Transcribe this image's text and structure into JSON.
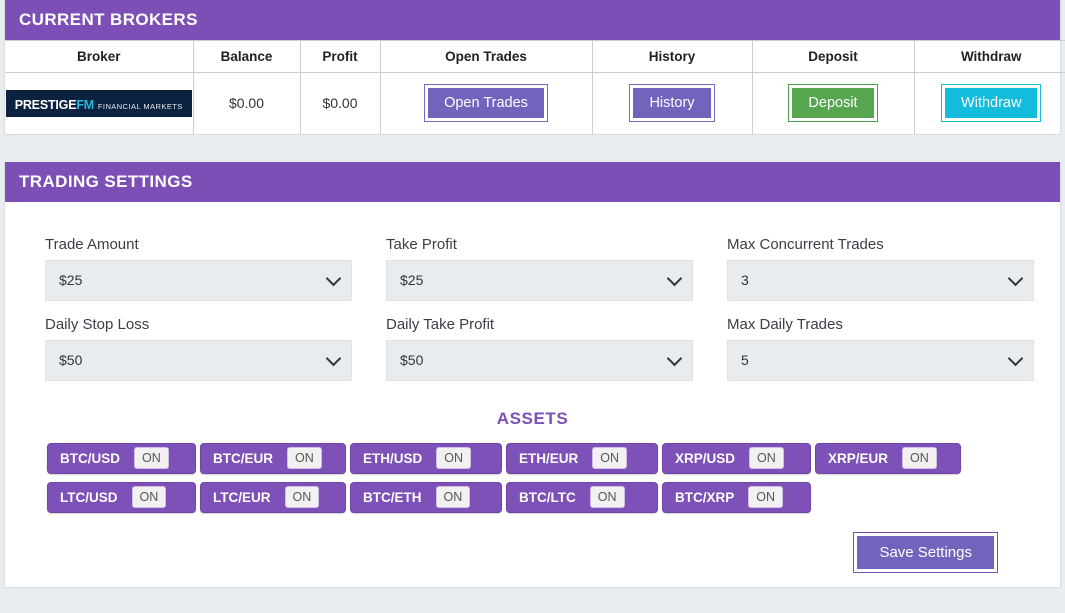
{
  "brokers": {
    "title": "CURRENT BROKERS",
    "columns": [
      "Broker",
      "Balance",
      "Profit",
      "Open Trades",
      "History",
      "Deposit",
      "Withdraw"
    ],
    "row": {
      "logo_top_main": "PRESTIGE",
      "logo_top_accent": "FM",
      "logo_bottom": "FINANCIAL MARKETS",
      "balance": "$0.00",
      "profit": "$0.00",
      "open_trades_label": "Open Trades",
      "history_label": "History",
      "deposit_label": "Deposit",
      "withdraw_label": "Withdraw"
    }
  },
  "settings": {
    "title": "TRADING SETTINGS",
    "fields": [
      {
        "label": "Trade Amount",
        "value": "$25"
      },
      {
        "label": "Take Profit",
        "value": "$25"
      },
      {
        "label": "Max Concurrent Trades",
        "value": "3"
      },
      {
        "label": "Daily Stop Loss",
        "value": "$50"
      },
      {
        "label": "Daily Take Profit",
        "value": "$50"
      },
      {
        "label": "Max Daily Trades",
        "value": "5"
      }
    ],
    "assets_title": "ASSETS",
    "assets_row1": [
      {
        "pair": "BTC/USD",
        "state": "ON"
      },
      {
        "pair": "BTC/EUR",
        "state": "ON"
      },
      {
        "pair": "ETH/USD",
        "state": "ON"
      },
      {
        "pair": "ETH/EUR",
        "state": "ON"
      },
      {
        "pair": "XRP/USD",
        "state": "ON"
      },
      {
        "pair": "XRP/EUR",
        "state": "ON"
      }
    ],
    "assets_row2": [
      {
        "pair": "LTC/USD",
        "state": "ON"
      },
      {
        "pair": "LTC/EUR",
        "state": "ON"
      },
      {
        "pair": "BTC/ETH",
        "state": "ON"
      },
      {
        "pair": "BTC/LTC",
        "state": "ON"
      },
      {
        "pair": "BTC/XRP",
        "state": "ON"
      }
    ],
    "save_label": "Save Settings"
  },
  "colors": {
    "header_purple": "#7b4fb5",
    "pill_purple": "#7d51b8",
    "button_purple": "#7164bd",
    "deposit_green": "#56a64f",
    "withdraw_cyan": "#13bcdb",
    "logo_navy": "#0c2340",
    "logo_accent_cyan": "#24b7e0",
    "page_background": "#e9edf0"
  }
}
